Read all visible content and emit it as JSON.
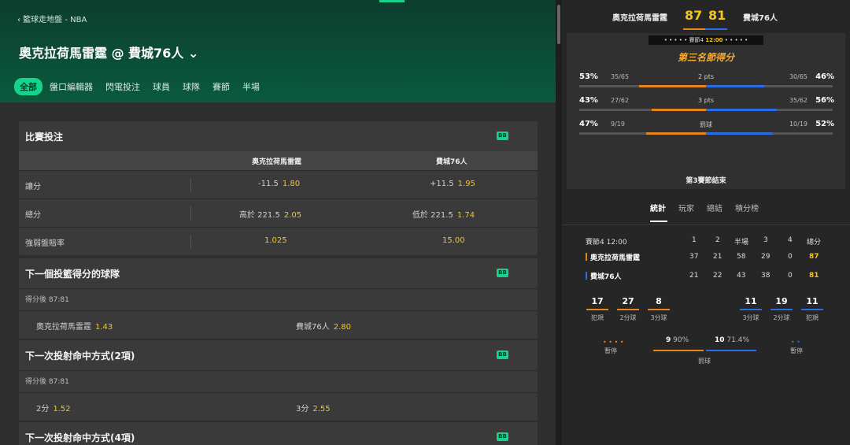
{
  "header": {
    "breadcrumb": "‹ 籃球走地盤 - NBA",
    "title": "奧克拉荷馬雷霆 @ 費城76人 ⌄",
    "tabs": [
      "全部",
      "盤口編輯器",
      "閃電投注",
      "球員",
      "球隊",
      "賽節",
      "半場"
    ]
  },
  "markets": {
    "match_bet": {
      "title": "比賽投注",
      "badge": "BB",
      "col_home": "奧克拉荷馬雷霆",
      "col_away": "費城76人",
      "rows": [
        {
          "label": "讓分",
          "home_line": "-11.5",
          "home_odd": "1.80",
          "away_line": "+11.5",
          "away_odd": "1.95"
        },
        {
          "label": "總分",
          "home_line": "高於 221.5",
          "home_odd": "2.05",
          "away_line": "低於 221.5",
          "away_odd": "1.74"
        },
        {
          "label": "強弱盤賠率",
          "home_line": "",
          "home_odd": "1.025",
          "away_line": "",
          "away_odd": "15.00"
        }
      ]
    },
    "next_team": {
      "title": "下一個投籃得分的球隊",
      "badge": "BB",
      "sub": "得分後 87:81",
      "home": "奧克拉荷馬雷霆",
      "home_odd": "1.43",
      "away": "費城76人",
      "away_odd": "2.80"
    },
    "next_shot2": {
      "title": "下一次投射命中方式(2項)",
      "badge": "BB",
      "sub": "得分後 87:81",
      "opt1": "2分",
      "opt1_odd": "1.52",
      "opt2": "3分",
      "opt2_odd": "2.55"
    },
    "next_shot4": {
      "title": "下一次投射命中方式(4項)",
      "badge": "BB"
    }
  },
  "scoreboard": {
    "home": "奧克拉荷馬雷霆",
    "away": "費城76人",
    "home_score": "87",
    "away_score": "81",
    "clock_dots_l": "• • • • •",
    "clock_period": "賽節4",
    "clock_time": "12:00",
    "clock_dots_r": "• • • • •",
    "quarter_title": "第三名節得分",
    "quarter_end": "第3賽節結束",
    "stats": [
      {
        "pct_l": "53%",
        "frac_l": "35/65",
        "label": "2 pts",
        "frac_r": "30/65",
        "pct_r": "46%",
        "home_share": 0.53,
        "away_share": 0.46
      },
      {
        "pct_l": "43%",
        "frac_l": "27/62",
        "label": "3 pts",
        "frac_r": "35/62",
        "pct_r": "56%",
        "home_share": 0.43,
        "away_share": 0.56
      },
      {
        "pct_l": "47%",
        "frac_l": "9/19",
        "label": "罰球",
        "frac_r": "10/19",
        "pct_r": "52%",
        "home_share": 0.47,
        "away_share": 0.52
      }
    ]
  },
  "right_tabs": [
    "統計",
    "玩家",
    "總結",
    "積分榜"
  ],
  "boxscore": {
    "period": "賽節4",
    "time": "12:00",
    "cols": [
      "1",
      "2",
      "半場",
      "3",
      "4",
      "總分"
    ],
    "home": {
      "name": "奧克拉荷馬雷霆",
      "vals": [
        "37",
        "21",
        "58",
        "29",
        "0"
      ],
      "total": "87"
    },
    "away": {
      "name": "費城76人",
      "vals": [
        "21",
        "22",
        "43",
        "38",
        "0"
      ],
      "total": "81"
    }
  },
  "team_stats": {
    "home": [
      {
        "n": "17",
        "l": "犯規"
      },
      {
        "n": "27",
        "l": "2分球"
      },
      {
        "n": "8",
        "l": "3分球"
      }
    ],
    "away": [
      {
        "n": "11",
        "l": "3分球"
      },
      {
        "n": "19",
        "l": "2分球"
      },
      {
        "n": "11",
        "l": "犯規"
      }
    ],
    "timeout_label": "暫停",
    "timeout_home": "• • • •",
    "timeout_away": "• •",
    "ft_home_n": "9",
    "ft_home_pct": "90%",
    "ft_away_n": "10",
    "ft_away_pct": "71.4%",
    "ft_label": "罰球"
  },
  "colors": {
    "accent": "#14d38a",
    "home": "#e8841c",
    "away": "#2a6ee6",
    "odds": "#f5c518"
  }
}
